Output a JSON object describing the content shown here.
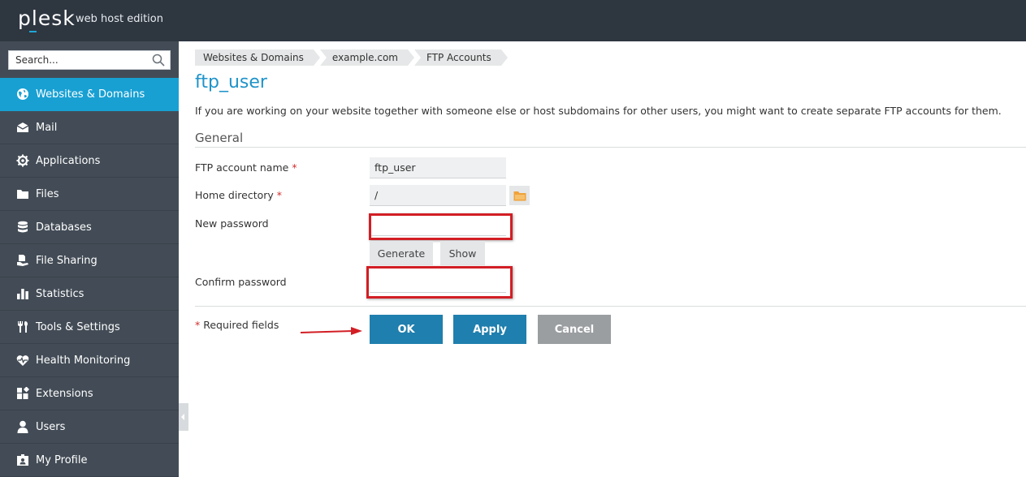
{
  "header": {
    "logo": "plesk",
    "edition": "web host edition"
  },
  "sidebar": {
    "search_placeholder": "Search...",
    "items": [
      {
        "label": "Websites & Domains",
        "icon": "globe-icon",
        "active": true
      },
      {
        "label": "Mail",
        "icon": "envelope-icon"
      },
      {
        "label": "Applications",
        "icon": "gear-icon"
      },
      {
        "label": "Files",
        "icon": "folder-icon"
      },
      {
        "label": "Databases",
        "icon": "database-icon"
      },
      {
        "label": "File Sharing",
        "icon": "file-sharing-icon"
      },
      {
        "label": "Statistics",
        "icon": "bar-chart-icon"
      },
      {
        "label": "Tools & Settings",
        "icon": "tools-icon"
      },
      {
        "label": "Health Monitoring",
        "icon": "heart-pulse-icon"
      },
      {
        "label": "Extensions",
        "icon": "extensions-icon"
      },
      {
        "label": "Users",
        "icon": "user-icon"
      },
      {
        "label": "My Profile",
        "icon": "profile-icon"
      }
    ]
  },
  "breadcrumb": [
    "Websites & Domains",
    "example.com",
    "FTP Accounts"
  ],
  "page": {
    "title": "ftp_user",
    "intro": "If you are working on your website together with someone else or host subdomains for other users, you might want to create separate FTP accounts for them.",
    "section": "General"
  },
  "form": {
    "account_name_label": "FTP account name",
    "account_name_value": "ftp_user",
    "home_dir_label": "Home directory",
    "home_dir_value": "/",
    "new_password_label": "New password",
    "new_password_value": "",
    "generate_label": "Generate",
    "show_label": "Show",
    "confirm_password_label": "Confirm password",
    "confirm_password_value": "",
    "required_mark": "*",
    "required_note": "Required fields"
  },
  "actions": {
    "ok": "OK",
    "apply": "Apply",
    "cancel": "Cancel"
  },
  "colors": {
    "header_bg": "#2e3640",
    "sidebar_bg": "#434c56",
    "active_item": "#18a0d3",
    "title": "#1f93c9",
    "primary_button": "#1f7fae",
    "cancel_button": "#9a9ea1",
    "highlight": "#d21e24"
  }
}
